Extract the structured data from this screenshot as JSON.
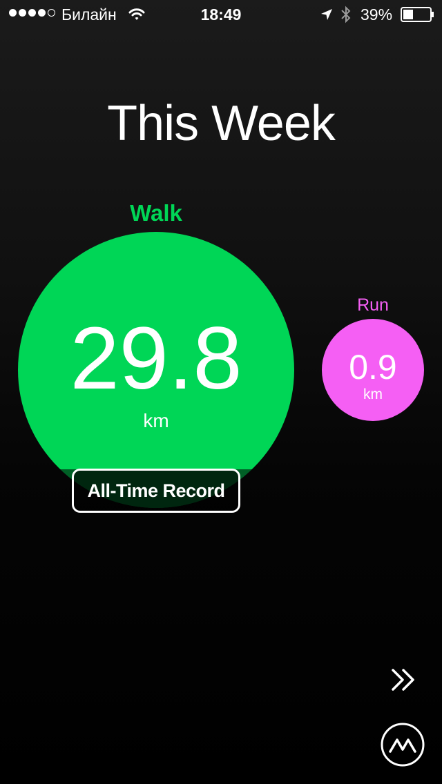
{
  "status_bar": {
    "carrier": "Билайн",
    "time": "18:49",
    "battery_percent": "39%",
    "signal_bars_filled": 4,
    "signal_bars_total": 5,
    "battery_level": 0.39
  },
  "title": "This Week",
  "activities": {
    "walk": {
      "label": "Walk",
      "value": "29.8",
      "unit": "km",
      "color": "#00d656"
    },
    "run": {
      "label": "Run",
      "value": "0.9",
      "unit": "km",
      "color": "#f55ff4"
    }
  },
  "badge": {
    "label": "All-Time Record"
  },
  "icons": {
    "next": "double-chevron-right-icon",
    "logo": "app-logo-icon",
    "wifi": "wifi-icon",
    "location": "location-arrow-icon",
    "bluetooth": "bluetooth-icon",
    "battery": "battery-icon"
  }
}
